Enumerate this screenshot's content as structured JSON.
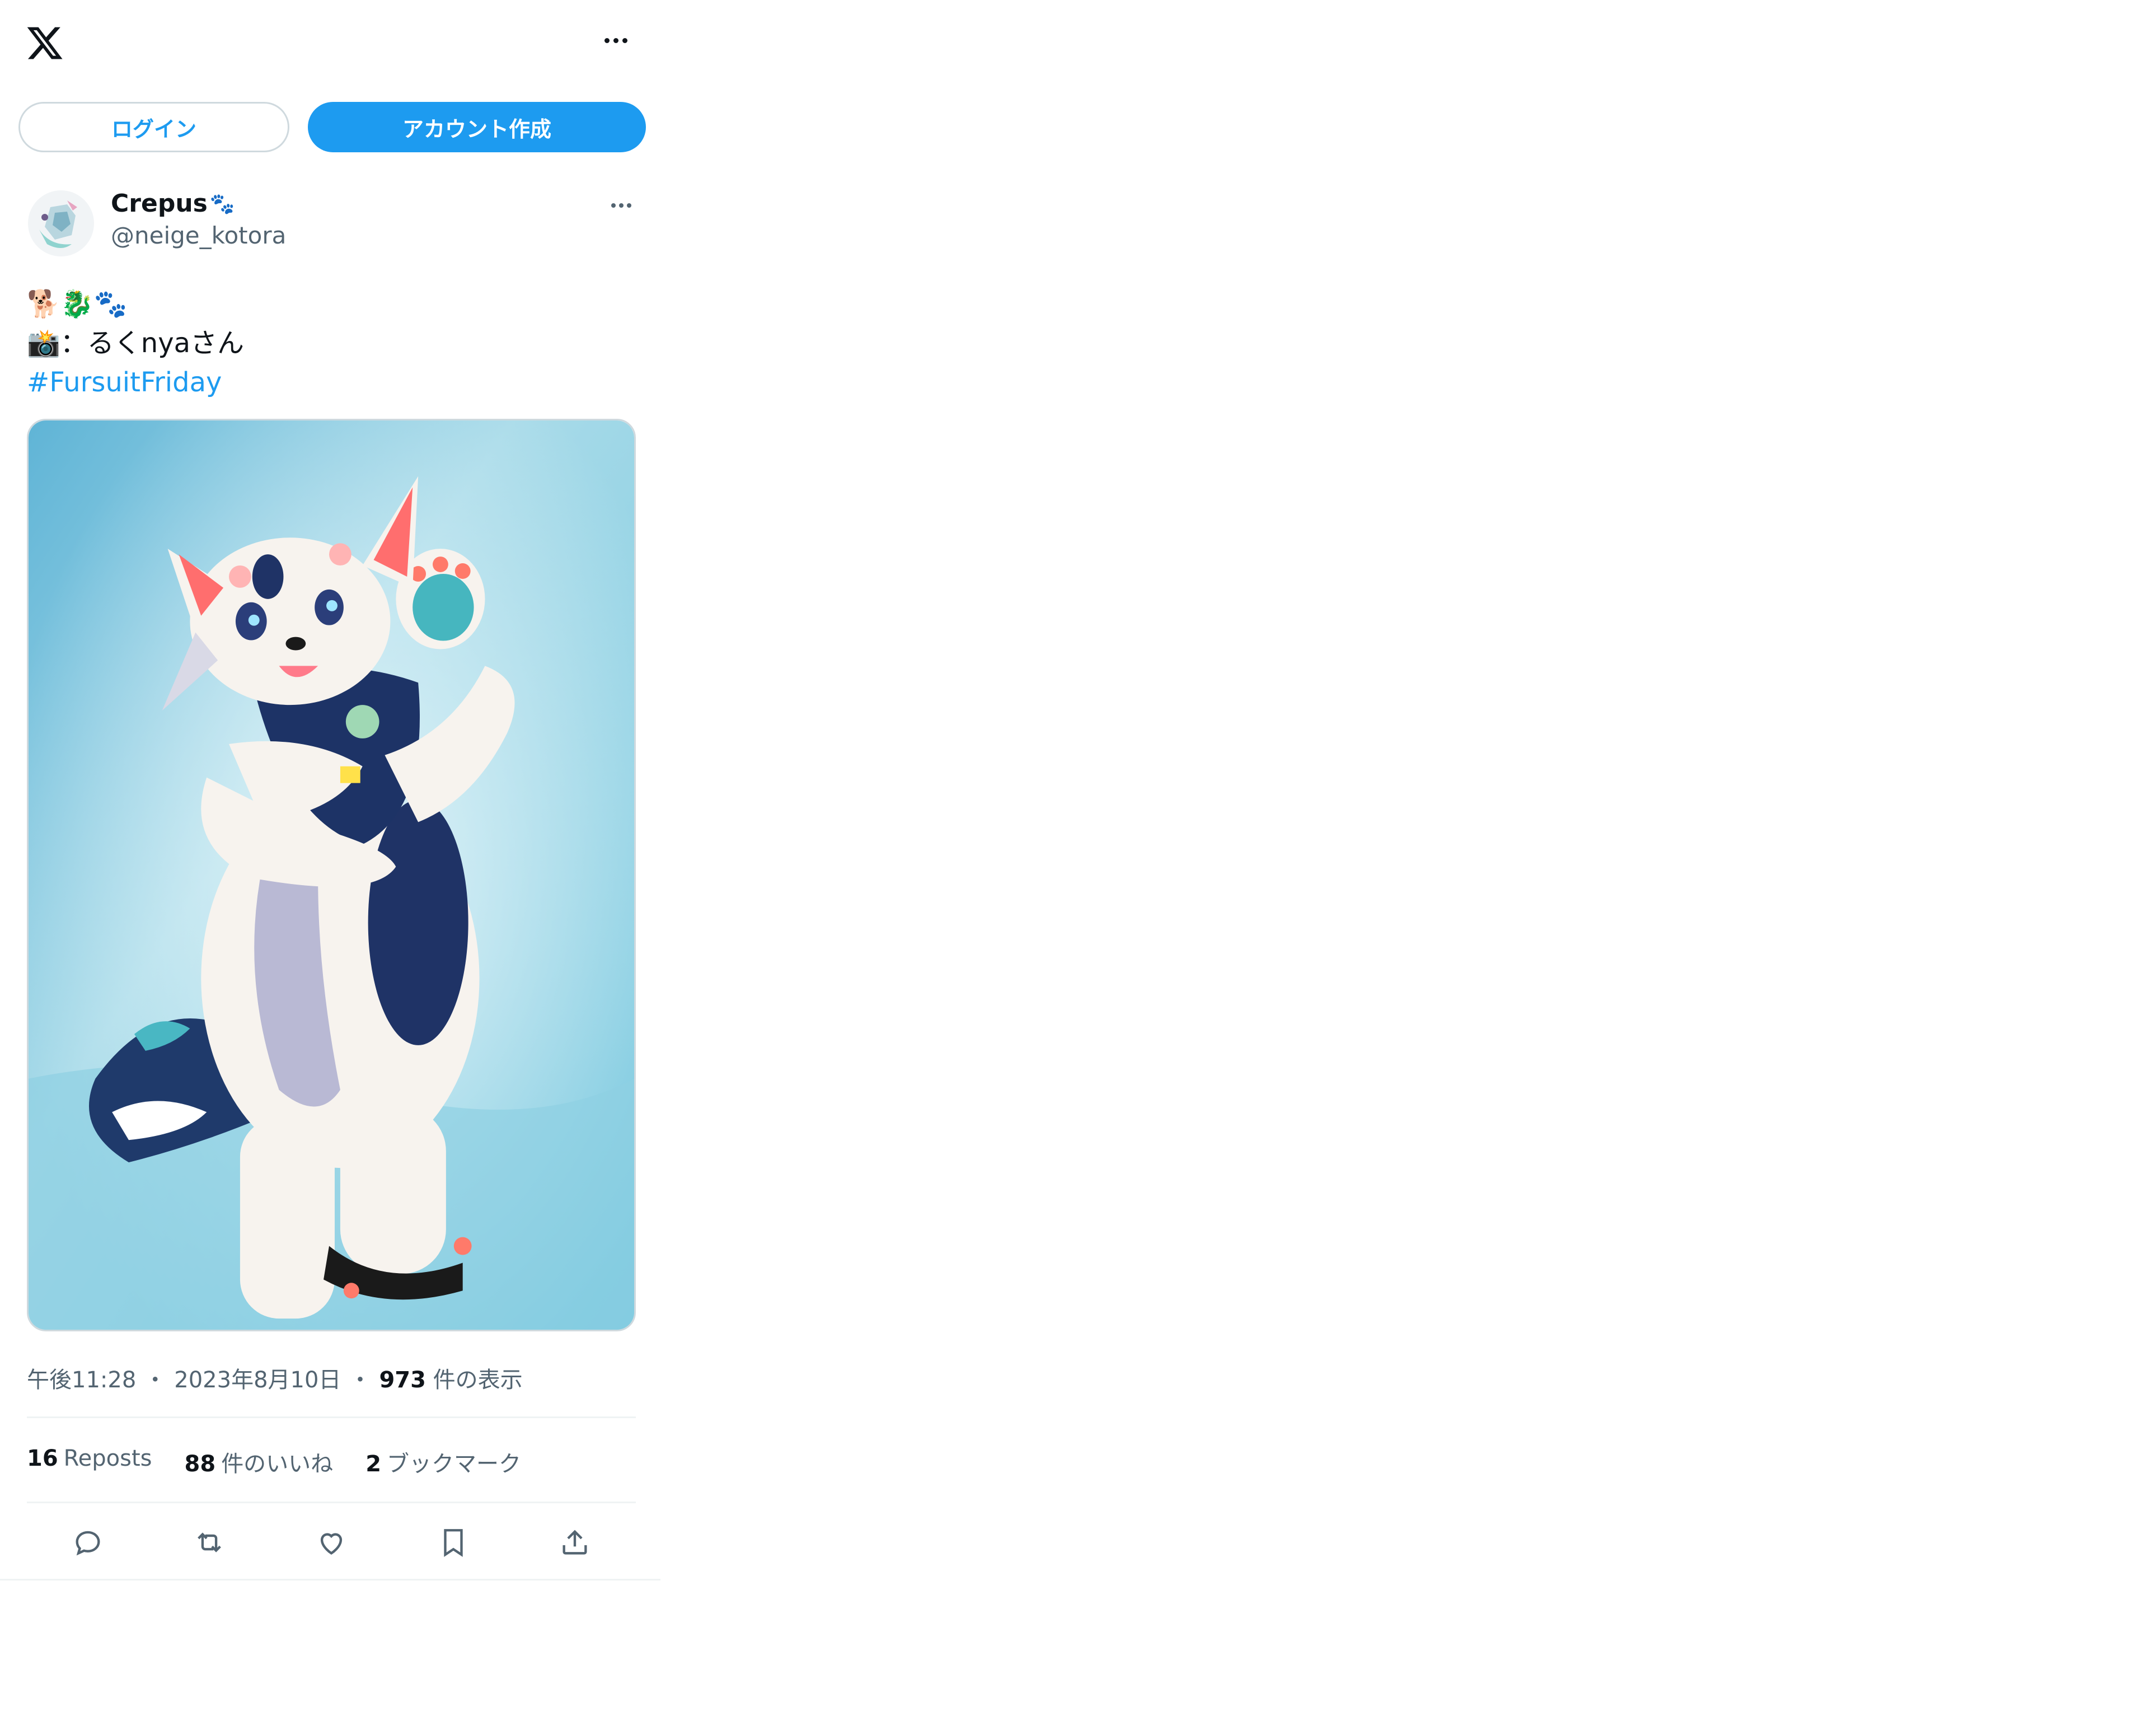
{
  "topbar": {
    "logo_icon": "x-logo-icon",
    "more_icon": "more-horizontal-icon"
  },
  "auth": {
    "login_label": "ログイン",
    "signup_label": "アカウント作成"
  },
  "author": {
    "name": "Crepus",
    "name_emoji": "🐾",
    "handle": "@neige_kotora"
  },
  "tweet": {
    "line1_emoji": "🐕🐉🐾",
    "line2_emoji": "📸",
    "line2_text": "：るくnyaさん",
    "hashtag": "#FursuitFriday"
  },
  "meta": {
    "time": "午後11:28",
    "date": "2023年8月10日",
    "views_count": "973",
    "views_label": "件の表示",
    "separator": "・"
  },
  "stats": {
    "reposts_count": "16",
    "reposts_label": "Reposts",
    "likes_count": "88",
    "likes_label": "件のいいね",
    "bookmarks_count": "2",
    "bookmarks_label": "ブックマーク"
  },
  "actions": [
    "reply-icon",
    "repost-icon",
    "like-icon",
    "bookmark-icon",
    "share-icon"
  ],
  "colors": {
    "accent": "#1d9bf0",
    "text": "#0f1419",
    "secondary": "#536471",
    "border": "#cfd9de"
  }
}
